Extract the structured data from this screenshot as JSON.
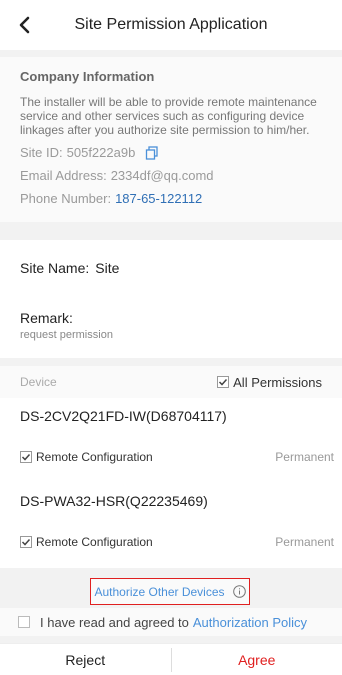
{
  "header": {
    "title": "Site Permission Application"
  },
  "company": {
    "section_title": "Company Information",
    "description": "The installer will be able to provide remote maintenance service and other services such as configuring device linkages after you authorize site permission to him/her.",
    "site_id_label": "Site ID:",
    "site_id": "505f222a9b",
    "email_label": "Email Address:",
    "email": "2334df@qq.comd",
    "phone_label": "Phone Number:",
    "phone": "187-65-122112"
  },
  "site": {
    "name_label": "Site Name:",
    "name": "Site"
  },
  "remark": {
    "label": "Remark:",
    "value": "request permission"
  },
  "devices": {
    "header_label": "Device",
    "all_permissions_label": "All Permissions",
    "items": [
      {
        "name": "DS-2CV2Q21FD-IW(D68704117)",
        "permission": "Remote Configuration",
        "duration": "Permanent"
      },
      {
        "name": "DS-PWA32-HSR(Q22235469)",
        "permission": "Remote Configuration",
        "duration": "Permanent"
      }
    ]
  },
  "authorize_other": {
    "label": "Authorize Other Devices"
  },
  "agreement": {
    "prefix": "I have read and agreed to",
    "link": "Authorization Policy"
  },
  "footer": {
    "reject_label": "Reject",
    "agree_label": "Agree"
  },
  "colors": {
    "accent_blue": "#4a90d9",
    "agree_red": "#e02020",
    "phone_blue": "#2f6fb5"
  }
}
